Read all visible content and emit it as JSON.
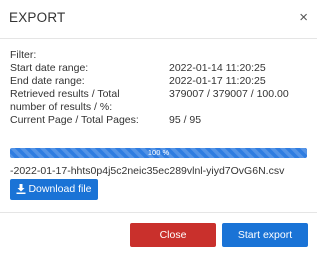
{
  "dialog": {
    "title": "EXPORT",
    "close_glyph": "×"
  },
  "info": {
    "filter_label": "Filter:",
    "start_label": "Start date range:",
    "start_value": "2022-01-14 11:20:25",
    "end_label": "End date range:",
    "end_value": "2022-01-17 11:20:25",
    "retrieved_label_1": "Retrieved results / Total",
    "retrieved_label_2": "number of results / %:",
    "retrieved_value": "379007 / 379007 / 100.00",
    "page_label": "Current Page / Total Pages:",
    "page_value": "95 / 95"
  },
  "progress": {
    "percent": 100,
    "label": "100 %",
    "color": "#2f7de1"
  },
  "file": {
    "name": "-2022-01-17-hhts0p4j5c2neic35ec289vlnl-yiyd7OvG6N.csv"
  },
  "buttons": {
    "download_label": "Download file",
    "download_icon": "download-icon",
    "close_label": "Close",
    "start_label": "Start export"
  },
  "colors": {
    "primary": "#1a73d6",
    "danger": "#c9302c"
  }
}
